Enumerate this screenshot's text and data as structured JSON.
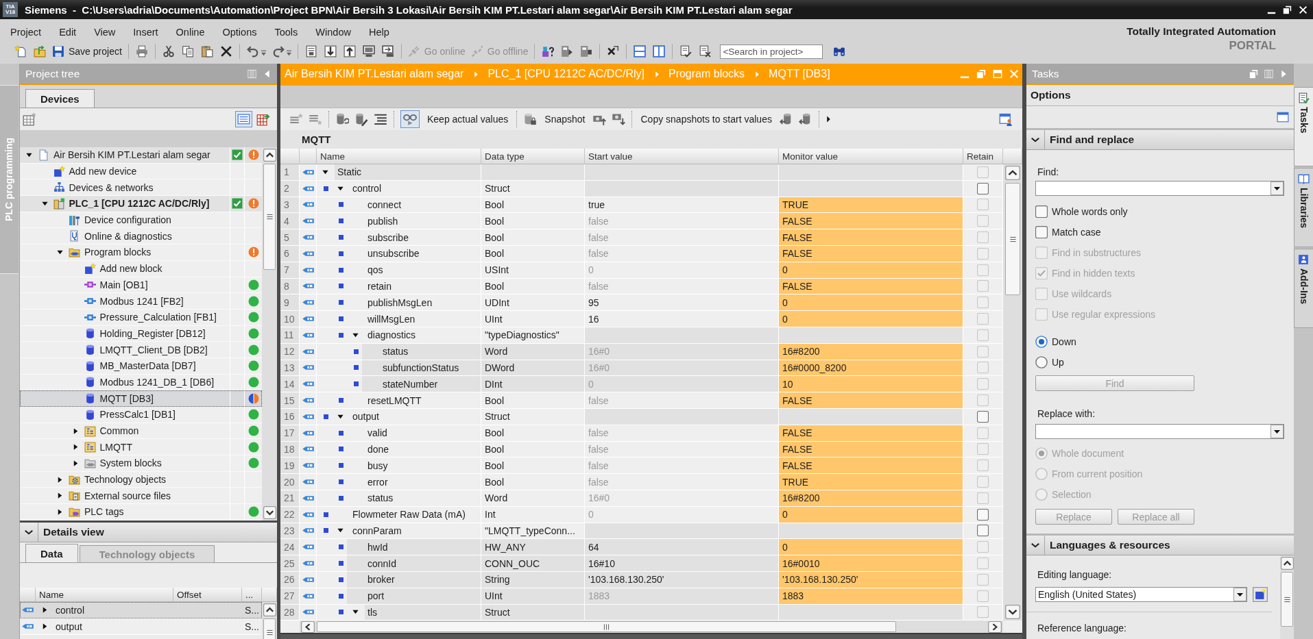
{
  "window": {
    "logo": [
      "TIA",
      "V18"
    ],
    "title": "Siemens  -  C:\\Users\\adria\\Documents\\Automation\\Project BPN\\Air Bersih 3 Lokasi\\Air Bersih KIM PT.Lestari alam segar\\Air Bersih KIM PT.Lestari alam segar"
  },
  "menu": [
    "Project",
    "Edit",
    "View",
    "Insert",
    "Online",
    "Options",
    "Tools",
    "Window",
    "Help"
  ],
  "toolbar": {
    "save": {
      "label": "Save project"
    },
    "online": [
      {
        "label": "Go online",
        "disabled": true
      },
      {
        "label": "Go offline",
        "disabled": true
      }
    ],
    "search": {
      "placeholder": "<Search in project>"
    }
  },
  "brand": {
    "title": "Totally Integrated Automation",
    "subtitle": "PORTAL"
  },
  "side_strip": {
    "label": "PLC programming"
  },
  "project_tree": {
    "title": "Project tree",
    "tabs": [
      {
        "label": "Devices",
        "selected": true
      }
    ],
    "list_view": true,
    "items": [
      {
        "kind": "project",
        "label": "Air Bersih KIM PT.Lestari alam segar",
        "expanded": true,
        "checkmark": true,
        "status": {
          "kind": "warning"
        },
        "selected": false,
        "children": [
          {
            "kind": "action",
            "label": "Add new device",
            "checkmark": false,
            "selected": false
          },
          {
            "kind": "network",
            "label": "Devices & networks",
            "checkmark": false,
            "selected": false
          },
          {
            "kind": "device",
            "label": "PLC_1 [CPU 1212C AC/DC/Rly]",
            "expanded": true,
            "checkmark": true,
            "status": {
              "kind": "warning"
            },
            "selected": false,
            "children": [
              {
                "kind": "config",
                "label": "Device configuration",
                "checkmark": false,
                "selected": false
              },
              {
                "kind": "diagnostics",
                "label": "Online & diagnostics",
                "checkmark": false,
                "selected": false
              },
              {
                "kind": "block-folder",
                "label": "Program blocks",
                "expanded": true,
                "checkmark": false,
                "status": {
                  "kind": "warning"
                },
                "selected": false,
                "children": [
                  {
                    "kind": "action",
                    "label": "Add new block",
                    "checkmark": false,
                    "selected": false
                  },
                  {
                    "kind": "ob",
                    "label": "Main [OB1]",
                    "checkmark": false,
                    "status": {
                      "kind": "ok"
                    },
                    "selected": false
                  },
                  {
                    "kind": "fb",
                    "label": "Modbus 1241 [FB2]",
                    "checkmark": false,
                    "status": {
                      "kind": "ok"
                    },
                    "selected": false
                  },
                  {
                    "kind": "fb",
                    "label": "Pressure_Calculation [FB1]",
                    "checkmark": false,
                    "status": {
                      "kind": "ok"
                    },
                    "selected": false
                  },
                  {
                    "kind": "db",
                    "label": "Holding_Register [DB12]",
                    "checkmark": false,
                    "status": {
                      "kind": "ok"
                    },
                    "selected": false
                  },
                  {
                    "kind": "db",
                    "label": "LMQTT_Client_DB [DB2]",
                    "checkmark": false,
                    "status": {
                      "kind": "ok"
                    },
                    "selected": false
                  },
                  {
                    "kind": "db",
                    "label": "MB_MasterData [DB7]",
                    "checkmark": false,
                    "status": {
                      "kind": "ok"
                    },
                    "selected": false
                  },
                  {
                    "kind": "db",
                    "label": "Modbus 1241_DB_1 [DB6]",
                    "checkmark": false,
                    "status": {
                      "kind": "ok"
                    },
                    "selected": false
                  },
                  {
                    "kind": "db",
                    "label": "MQTT [DB3]",
                    "checkmark": false,
                    "status": {
                      "kind": "partial"
                    },
                    "selected": true
                  },
                  {
                    "kind": "db",
                    "label": "PressCalc1 [DB1]",
                    "checkmark": false,
                    "status": {
                      "kind": "ok"
                    },
                    "selected": false
                  },
                  {
                    "kind": "group",
                    "label": "Common",
                    "expanded": false,
                    "checkmark": false,
                    "status": {
                      "kind": "ok"
                    },
                    "selected": false
                  },
                  {
                    "kind": "group",
                    "label": "LMQTT",
                    "expanded": false,
                    "checkmark": false,
                    "status": {
                      "kind": "ok"
                    },
                    "selected": false
                  },
                  {
                    "kind": "system-group",
                    "label": "System blocks",
                    "expanded": false,
                    "checkmark": false,
                    "status": {
                      "kind": "ok"
                    },
                    "selected": false
                  }
                ]
              },
              {
                "kind": "tech-folder",
                "label": "Technology objects",
                "expanded": false,
                "checkmark": false,
                "selected": false
              },
              {
                "kind": "source-folder",
                "label": "External source files",
                "expanded": false,
                "checkmark": false,
                "selected": false
              },
              {
                "kind": "tags-folder",
                "label": "PLC tags",
                "expanded": false,
                "checkmark": false,
                "status": {
                  "kind": "ok"
                },
                "selected": false
              }
            ]
          }
        ]
      }
    ]
  },
  "details_view": {
    "title": "Details view",
    "expanded": true,
    "tabs": [
      {
        "label": "Data",
        "selected": true
      },
      {
        "label": "Technology objects",
        "selected": false
      }
    ],
    "columns": [
      "Name",
      "Offset",
      "..."
    ],
    "rows": [
      {
        "name": "control",
        "column_3": "S...",
        "expanded": false,
        "selected": true
      },
      {
        "name": "output",
        "column_3": "S...",
        "expanded": false,
        "selected": false
      }
    ]
  },
  "editor": {
    "breadcrumb": [
      "Air Bersih KIM PT.Lestari alam segar",
      "PLC_1 [CPU 1212C AC/DC/Rly]",
      "Program blocks",
      "MQTT [DB3]"
    ],
    "toolbar": {
      "monitoring": true,
      "keep_label": "Keep actual values",
      "snapshot_label": "Snapshot",
      "copy_label": "Copy snapshots to start values"
    },
    "block_name": "MQTT",
    "columns": [
      "Name",
      "Data type",
      "Start value",
      "Monitor value",
      "Retain"
    ],
    "rows": [
      {
        "no": "1",
        "name": "Static",
        "expanded": true,
        "readonly": true,
        "retain_checked": false,
        "retain_disabled": true,
        "children": [
          {
            "no": "2",
            "name": "control",
            "type": "Struct",
            "expanded": true,
            "readonly": false,
            "retain_checked": false,
            "retain_disabled": false,
            "children": [
              {
                "no": "3",
                "name": "connect",
                "type": "Bool",
                "start": "true",
                "start_default": false,
                "monitor": "TRUE",
                "readonly": false,
                "retain_checked": false,
                "retain_disabled": true
              },
              {
                "no": "4",
                "name": "publish",
                "type": "Bool",
                "start": "false",
                "start_default": true,
                "monitor": "FALSE",
                "readonly": false,
                "retain_checked": false,
                "retain_disabled": true
              },
              {
                "no": "5",
                "name": "subscribe",
                "type": "Bool",
                "start": "false",
                "start_default": true,
                "monitor": "FALSE",
                "readonly": false,
                "retain_checked": false,
                "retain_disabled": true
              },
              {
                "no": "6",
                "name": "unsubscribe",
                "type": "Bool",
                "start": "false",
                "start_default": true,
                "monitor": "FALSE",
                "readonly": false,
                "retain_checked": false,
                "retain_disabled": true
              },
              {
                "no": "7",
                "name": "qos",
                "type": "USInt",
                "start": "0",
                "start_default": true,
                "monitor": "0",
                "readonly": false,
                "retain_checked": false,
                "retain_disabled": true
              },
              {
                "no": "8",
                "name": "retain",
                "type": "Bool",
                "start": "false",
                "start_default": true,
                "monitor": "FALSE",
                "readonly": false,
                "retain_checked": false,
                "retain_disabled": true
              },
              {
                "no": "9",
                "name": "publishMsgLen",
                "type": "UDInt",
                "start": "95",
                "start_default": false,
                "monitor": "0",
                "readonly": false,
                "retain_checked": false,
                "retain_disabled": true
              },
              {
                "no": "10",
                "name": "willMsgLen",
                "type": "UInt",
                "start": "16",
                "start_default": false,
                "monitor": "0",
                "readonly": false,
                "retain_checked": false,
                "retain_disabled": true
              },
              {
                "no": "11",
                "name": "diagnostics",
                "type": "\"typeDiagnostics\"",
                "expanded": true,
                "readonly": false,
                "retain_checked": false,
                "retain_disabled": true,
                "children": [
                  {
                    "no": "12",
                    "name": "status",
                    "type": "Word",
                    "start": "16#0",
                    "start_default": true,
                    "monitor": "16#8200",
                    "readonly": true,
                    "retain_checked": false,
                    "retain_disabled": true
                  },
                  {
                    "no": "13",
                    "name": "subfunctionStatus",
                    "type": "DWord",
                    "start": "16#0",
                    "start_default": true,
                    "monitor": "16#0000_8200",
                    "readonly": true,
                    "retain_checked": false,
                    "retain_disabled": true
                  },
                  {
                    "no": "14",
                    "name": "stateNumber",
                    "type": "DInt",
                    "start": "0",
                    "start_default": true,
                    "monitor": "10",
                    "readonly": true,
                    "retain_checked": false,
                    "retain_disabled": true
                  }
                ]
              },
              {
                "no": "15",
                "name": "resetLMQTT",
                "type": "Bool",
                "start": "false",
                "start_default": true,
                "monitor": "FALSE",
                "readonly": false,
                "retain_checked": false,
                "retain_disabled": true
              }
            ]
          },
          {
            "no": "16",
            "name": "output",
            "type": "Struct",
            "expanded": true,
            "readonly": false,
            "retain_checked": false,
            "retain_disabled": false,
            "children": [
              {
                "no": "17",
                "name": "valid",
                "type": "Bool",
                "start": "false",
                "start_default": true,
                "monitor": "FALSE",
                "readonly": false,
                "retain_checked": false,
                "retain_disabled": true
              },
              {
                "no": "18",
                "name": "done",
                "type": "Bool",
                "start": "false",
                "start_default": true,
                "monitor": "FALSE",
                "readonly": false,
                "retain_checked": false,
                "retain_disabled": true
              },
              {
                "no": "19",
                "name": "busy",
                "type": "Bool",
                "start": "false",
                "start_default": true,
                "monitor": "FALSE",
                "readonly": false,
                "retain_checked": false,
                "retain_disabled": true
              },
              {
                "no": "20",
                "name": "error",
                "type": "Bool",
                "start": "false",
                "start_default": true,
                "monitor": "TRUE",
                "readonly": false,
                "retain_checked": false,
                "retain_disabled": true
              },
              {
                "no": "21",
                "name": "status",
                "type": "Word",
                "start": "16#0",
                "start_default": true,
                "monitor": "16#8200",
                "readonly": false,
                "retain_checked": false,
                "retain_disabled": true
              }
            ]
          },
          {
            "no": "22",
            "name": "Flowmeter Raw Data (mA)",
            "type": "Int",
            "start": "0",
            "start_default": true,
            "monitor": "0",
            "readonly": false,
            "retain_checked": false,
            "retain_disabled": false
          },
          {
            "no": "23",
            "name": "connParam",
            "type": "\"LMQTT_typeConn...",
            "expanded": true,
            "readonly": false,
            "retain_checked": false,
            "retain_disabled": false,
            "children": [
              {
                "no": "24",
                "name": "hwId",
                "type": "HW_ANY",
                "start": "64",
                "start_default": false,
                "monitor": "0",
                "readonly": true,
                "retain_checked": false,
                "retain_disabled": true
              },
              {
                "no": "25",
                "name": "connId",
                "type": "CONN_OUC",
                "start": "16#10",
                "start_default": false,
                "monitor": "16#0010",
                "readonly": true,
                "retain_checked": false,
                "retain_disabled": true
              },
              {
                "no": "26",
                "name": "broker",
                "type": "String",
                "start": "'103.168.130.250'",
                "start_default": false,
                "monitor": "'103.168.130.250'",
                "readonly": true,
                "retain_checked": false,
                "retain_disabled": true
              },
              {
                "no": "27",
                "name": "port",
                "type": "UInt",
                "start": "1883",
                "start_default": true,
                "monitor": "1883",
                "readonly": true,
                "retain_checked": false,
                "retain_disabled": true
              },
              {
                "no": "28",
                "name": "tls",
                "type": "Struct",
                "expanded": true,
                "readonly": true,
                "retain_checked": false,
                "retain_disabled": true
              }
            ]
          }
        ]
      }
    ]
  },
  "tasks": {
    "title": "Tasks",
    "section": "Options",
    "find_replace": {
      "title": "Find and replace",
      "expanded": true,
      "find": {
        "label": "Find:"
      },
      "options": [
        {
          "label": "Whole words only",
          "checked": false,
          "disabled": false
        },
        {
          "label": "Match case",
          "checked": false,
          "disabled": false
        },
        {
          "label": "Find in substructures",
          "checked": false,
          "disabled": true
        },
        {
          "label": "Find in hidden texts",
          "checked": true,
          "disabled": true
        },
        {
          "label": "Use wildcards",
          "checked": false,
          "disabled": true
        },
        {
          "label": "Use regular expressions",
          "checked": false,
          "disabled": true
        }
      ],
      "direction": [
        {
          "label": "Down",
          "selected": true,
          "disabled": false
        },
        {
          "label": "Up",
          "selected": false,
          "disabled": false
        }
      ],
      "find_button": {
        "label": "Find",
        "disabled": true
      },
      "replace": {
        "label": "Replace with:"
      },
      "scope": [
        {
          "label": "Whole document",
          "selected": true,
          "disabled": true
        },
        {
          "label": "From current position",
          "selected": false,
          "disabled": true
        },
        {
          "label": "Selection",
          "selected": false,
          "disabled": true
        }
      ],
      "buttons": [
        {
          "label": "Replace",
          "disabled": true
        },
        {
          "label": "Replace all",
          "disabled": true
        }
      ]
    },
    "languages": {
      "title": "Languages & resources",
      "expanded": true,
      "editing": {
        "label": "Editing language:",
        "value": "English (United States)"
      },
      "reference": {
        "label": "Reference language:"
      }
    }
  },
  "right_tabs": [
    {
      "label": "Tasks",
      "selected": true
    },
    {
      "label": "Libraries",
      "selected": false
    },
    {
      "label": "Add-Ins",
      "selected": false
    }
  ]
}
